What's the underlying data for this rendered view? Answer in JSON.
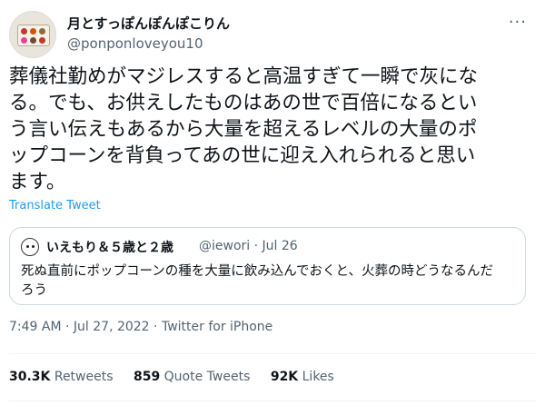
{
  "author": {
    "display_name": "月とすっぽんぽんぽこりん",
    "handle": "@ponponloveyou10"
  },
  "more_label": "···",
  "tweet": {
    "lines": [
      "葬儀社勤めがマジレスすると高温すぎて一瞬で灰にな",
      "る。でも、お供えしたものはあの世で百倍になるとい",
      "う言い伝えもあるから大量を超えるレベルの大量のポ",
      "ップコーンを背負ってあの世に迎え入れられると思い",
      "ます。"
    ],
    "translate_label": "Translate Tweet"
  },
  "quote": {
    "name": "いえもり＆５歳と２歳",
    "handle_date": "@iewori · Jul 26",
    "lines": [
      "死ぬ直前にポップコーンの種を大量に飲み込んでおくと、火葬の時どうなるんだ",
      "ろう"
    ]
  },
  "meta": {
    "time": "7:49 AM",
    "date": "Jul 27, 2022",
    "source": "Twitter for iPhone"
  },
  "stats": {
    "retweets_count": "30.3K",
    "retweets_label": "Retweets",
    "quotes_count": "859",
    "quotes_label": "Quote Tweets",
    "likes_count": "92K",
    "likes_label": "Likes"
  }
}
